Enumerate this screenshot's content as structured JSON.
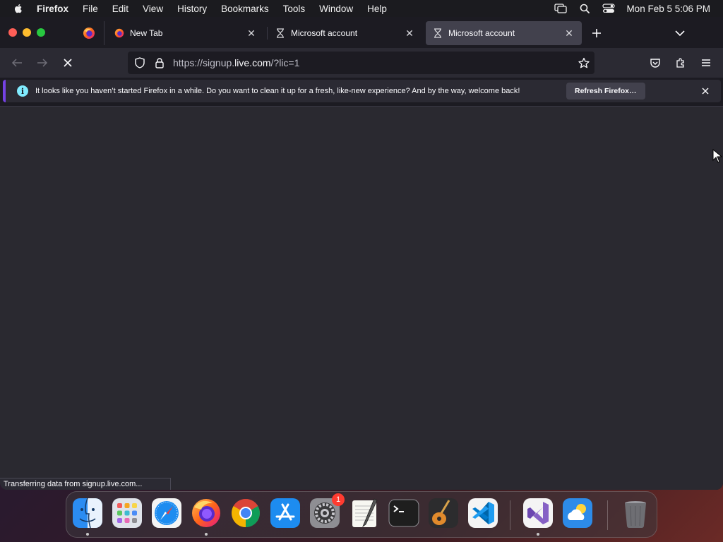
{
  "menubar": {
    "apple_icon": "apple-icon",
    "app_name": "Firefox",
    "items": [
      "File",
      "Edit",
      "View",
      "History",
      "Bookmarks",
      "Tools",
      "Window",
      "Help"
    ],
    "status_icons": [
      "screen-mirroring-icon",
      "spotlight-search-icon",
      "control-center-icon"
    ],
    "clock": "Mon Feb 5  5:06 PM"
  },
  "tabs": {
    "pinned": {
      "icon": "firefox-icon"
    },
    "items": [
      {
        "label": "New Tab",
        "icon": "firefox-icon",
        "active": false
      },
      {
        "label": "Microsoft account",
        "icon": "hourglass-icon",
        "active": false
      },
      {
        "label": "Microsoft account",
        "icon": "hourglass-icon",
        "active": true
      }
    ],
    "new_tab_icon": "plus-icon",
    "tab_list_icon": "chevron-down-icon"
  },
  "navbar": {
    "back_icon": "back-arrow-icon",
    "forward_icon": "forward-arrow-icon",
    "stop_icon": "stop-x-icon",
    "url_prefix": "https://signup.",
    "url_host": "live.com",
    "url_suffix": "/?lic=1",
    "pocket_icon": "pocket-icon",
    "extensions_icon": "extensions-icon",
    "menu_icon": "hamburger-menu-icon"
  },
  "notification": {
    "text": "It looks like you haven’t started Firefox in a while. Do you want to clean it up for a fresh, like-new experience? And by the way, welcome back!",
    "button_label": "Refresh Firefox…",
    "info_glyph": "i"
  },
  "status": {
    "text": "Transferring data from signup.live.com..."
  },
  "dock": {
    "apps": [
      {
        "name": "Finder",
        "running": true
      },
      {
        "name": "Launchpad",
        "running": false
      },
      {
        "name": "Safari",
        "running": false
      },
      {
        "name": "Firefox",
        "running": true
      },
      {
        "name": "Google Chrome",
        "running": false
      },
      {
        "name": "App Store",
        "running": false
      },
      {
        "name": "System Settings",
        "running": false,
        "badge": "1"
      },
      {
        "name": "TextEdit",
        "running": false
      },
      {
        "name": "Terminal",
        "running": false
      },
      {
        "name": "GarageBand",
        "running": false
      },
      {
        "name": "Visual Studio Code",
        "running": false
      },
      {
        "name": "Visual Studio",
        "running": true
      },
      {
        "name": "Weather",
        "running": false
      },
      {
        "name": "Trash",
        "running": false
      }
    ]
  },
  "colors": {
    "accent": "#7542e5",
    "info": "#80ebff",
    "toolbar": "#2b2a33",
    "tabstrip": "#1c1b22"
  }
}
